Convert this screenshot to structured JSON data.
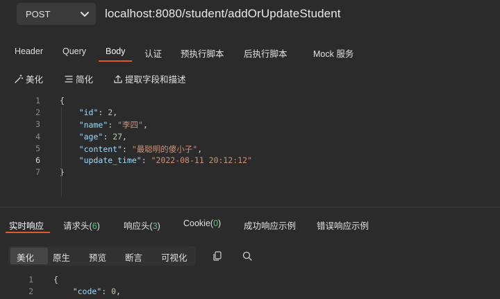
{
  "request": {
    "method": "POST",
    "url": "localhost:8080/student/addOrUpdateStudent"
  },
  "request_tabs": [
    "Header",
    "Query",
    "Body",
    "认证",
    "预执行脚本",
    "后执行脚本",
    "Mock 服务"
  ],
  "active_request_tab": "Body",
  "body_toolbar": {
    "beautify": "美化",
    "simplify": "简化",
    "extract": "提取字段和描述"
  },
  "request_body": {
    "line_numbers": [
      "1",
      "2",
      "3",
      "4",
      "5",
      "6",
      "7"
    ],
    "current_line": "6",
    "lines": [
      [
        {
          "t": "p",
          "v": "{"
        }
      ],
      [
        {
          "t": "p",
          "v": "    "
        },
        {
          "t": "k",
          "v": "\"id\""
        },
        {
          "t": "p",
          "v": ": "
        },
        {
          "t": "n",
          "v": "2"
        },
        {
          "t": "p",
          "v": ","
        }
      ],
      [
        {
          "t": "p",
          "v": "    "
        },
        {
          "t": "k",
          "v": "\"name\""
        },
        {
          "t": "p",
          "v": ": "
        },
        {
          "t": "s",
          "v": "\"李四\""
        },
        {
          "t": "p",
          "v": ","
        }
      ],
      [
        {
          "t": "p",
          "v": "    "
        },
        {
          "t": "k",
          "v": "\"age\""
        },
        {
          "t": "p",
          "v": ": "
        },
        {
          "t": "n",
          "v": "27"
        },
        {
          "t": "p",
          "v": ","
        }
      ],
      [
        {
          "t": "p",
          "v": "    "
        },
        {
          "t": "k",
          "v": "\"content\""
        },
        {
          "t": "p",
          "v": ": "
        },
        {
          "t": "s",
          "v": "\"最聪明的傻小子\""
        },
        {
          "t": "p",
          "v": ","
        }
      ],
      [
        {
          "t": "p",
          "v": "    "
        },
        {
          "t": "k",
          "v": "\"update_time\""
        },
        {
          "t": "p",
          "v": ": "
        },
        {
          "t": "s",
          "v": "\"2022-08-11 20:12:12\""
        }
      ],
      [
        {
          "t": "p",
          "v": "}"
        }
      ]
    ]
  },
  "response_tabs": {
    "realtime": "实时响应",
    "req_headers": "请求头",
    "req_headers_count": "6",
    "resp_headers": "响应头",
    "resp_headers_count": "3",
    "cookie": "Cookie",
    "cookie_count": "0",
    "success_example": "成功响应示例",
    "error_example": "错误响应示例"
  },
  "response_view": [
    "美化",
    "原生",
    "预览",
    "断言",
    "可视化"
  ],
  "active_response_view": "美化",
  "response_body": {
    "line_numbers": [
      "1",
      "2"
    ],
    "lines": [
      [
        {
          "t": "p",
          "v": "{"
        }
      ],
      [
        {
          "t": "p",
          "v": "    "
        },
        {
          "t": "k",
          "v": "\"code\""
        },
        {
          "t": "p",
          "v": ": "
        },
        {
          "t": "n",
          "v": "0"
        },
        {
          "t": "p",
          "v": ","
        }
      ]
    ]
  },
  "colors": {
    "accent": "#e05a2a",
    "count": "#5cc27a",
    "key": "#9cdcfe",
    "string": "#ce9178",
    "number": "#b5cea8"
  },
  "icons": [
    "chevron-down-icon",
    "magic-wand-icon",
    "list-icon",
    "extract-icon",
    "copy-icon",
    "search-icon"
  ]
}
